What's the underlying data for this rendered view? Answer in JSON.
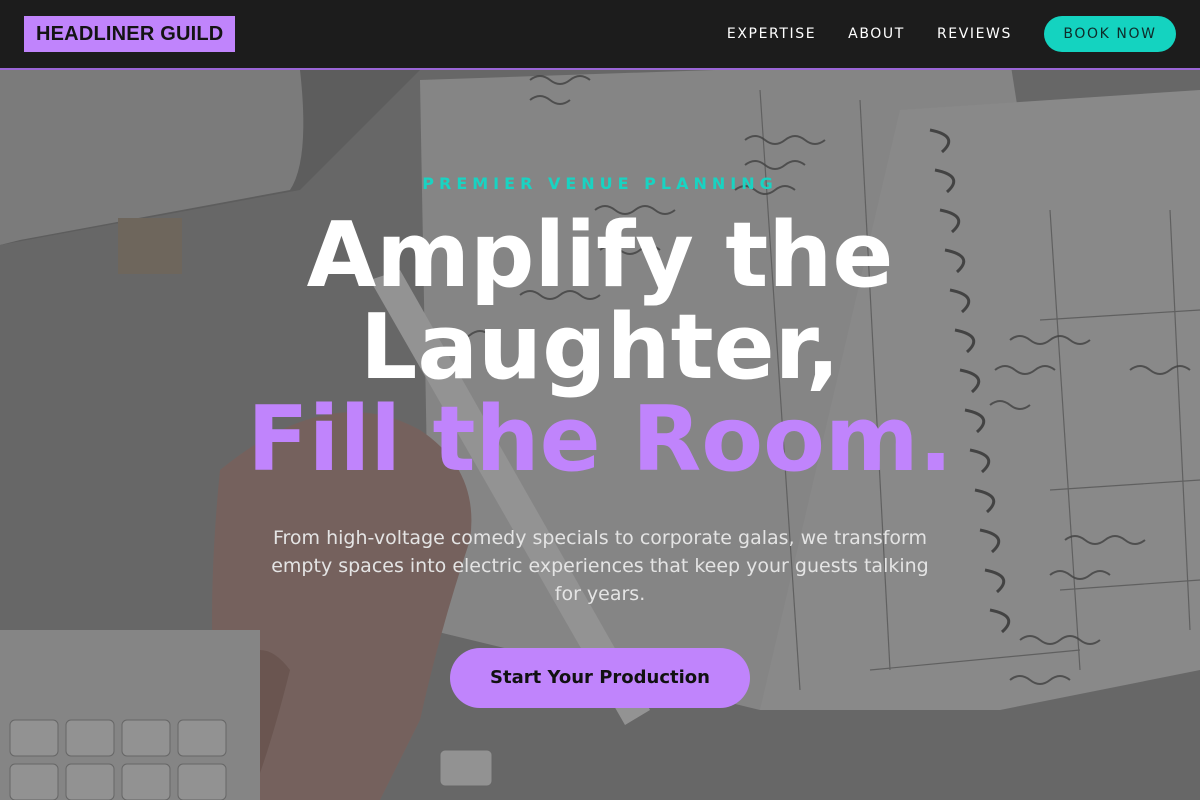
{
  "header": {
    "logo": "HEADLINER GUILD",
    "nav": [
      {
        "label": "EXPERTISE"
      },
      {
        "label": "ABOUT"
      },
      {
        "label": "REVIEWS"
      }
    ],
    "book_label": "BOOK NOW"
  },
  "hero": {
    "eyebrow": "PREMIER VENUE PLANNING",
    "headline_line1": "Amplify the",
    "headline_line2": "Laughter,",
    "headline_line3": "Fill the Room.",
    "subtext": "From high-voltage comedy specials to corporate galas, we transform empty spaces into electric experiences that keep your guests talking for years.",
    "cta_label": "Start Your Production"
  },
  "colors": {
    "accent_purple": "#c084fc",
    "accent_teal": "#14d3c0",
    "header_bg": "#1c1c1c"
  }
}
